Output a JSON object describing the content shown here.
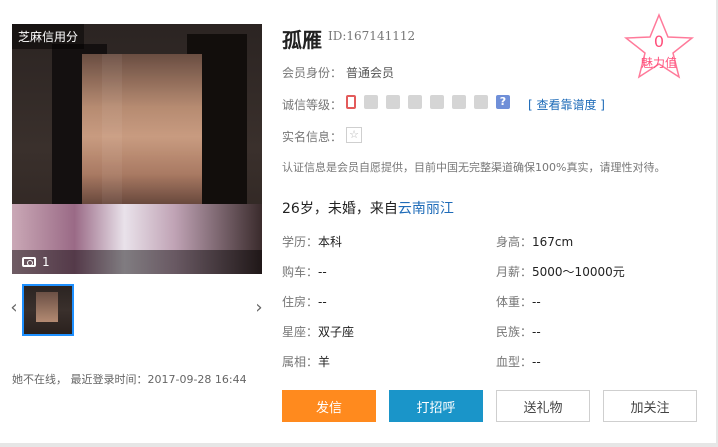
{
  "photo": {
    "badge": "芝麻信用分",
    "count": "1"
  },
  "status": {
    "text": "她不在线， 最近登录时间：2017-09-28 16:44"
  },
  "profile": {
    "name": "孤雁",
    "id": "ID:167141112",
    "membership_label": "会员身份：",
    "membership_value": "普通会员",
    "integrity_label": "诚信等级：",
    "integrity_link": "[ 查看靠谱度 ]",
    "realname_label": "实名信息：",
    "note": "认证信息是会员自愿提供，目前中国无完整渠道确保100%真实，请理性对待。",
    "summary_prefix": "26岁，未婚，来自",
    "summary_location": "云南丽江",
    "fields_left": [
      {
        "label": "学历：",
        "value": "本科"
      },
      {
        "label": "购车：",
        "value": "--"
      },
      {
        "label": "住房：",
        "value": "--"
      },
      {
        "label": "星座：",
        "value": "双子座"
      },
      {
        "label": "属相：",
        "value": "羊"
      }
    ],
    "fields_right": [
      {
        "label": "身高：",
        "value": "167cm"
      },
      {
        "label": "月薪：",
        "value": "5000～10000元"
      },
      {
        "label": "体重：",
        "value": "--"
      },
      {
        "label": "民族：",
        "value": "--"
      },
      {
        "label": "血型：",
        "value": "--"
      }
    ]
  },
  "charm": {
    "value": "0",
    "label": "魅力值"
  },
  "buttons": {
    "message": "发信",
    "greet": "打招呼",
    "gift": "送礼物",
    "follow": "加关注"
  }
}
